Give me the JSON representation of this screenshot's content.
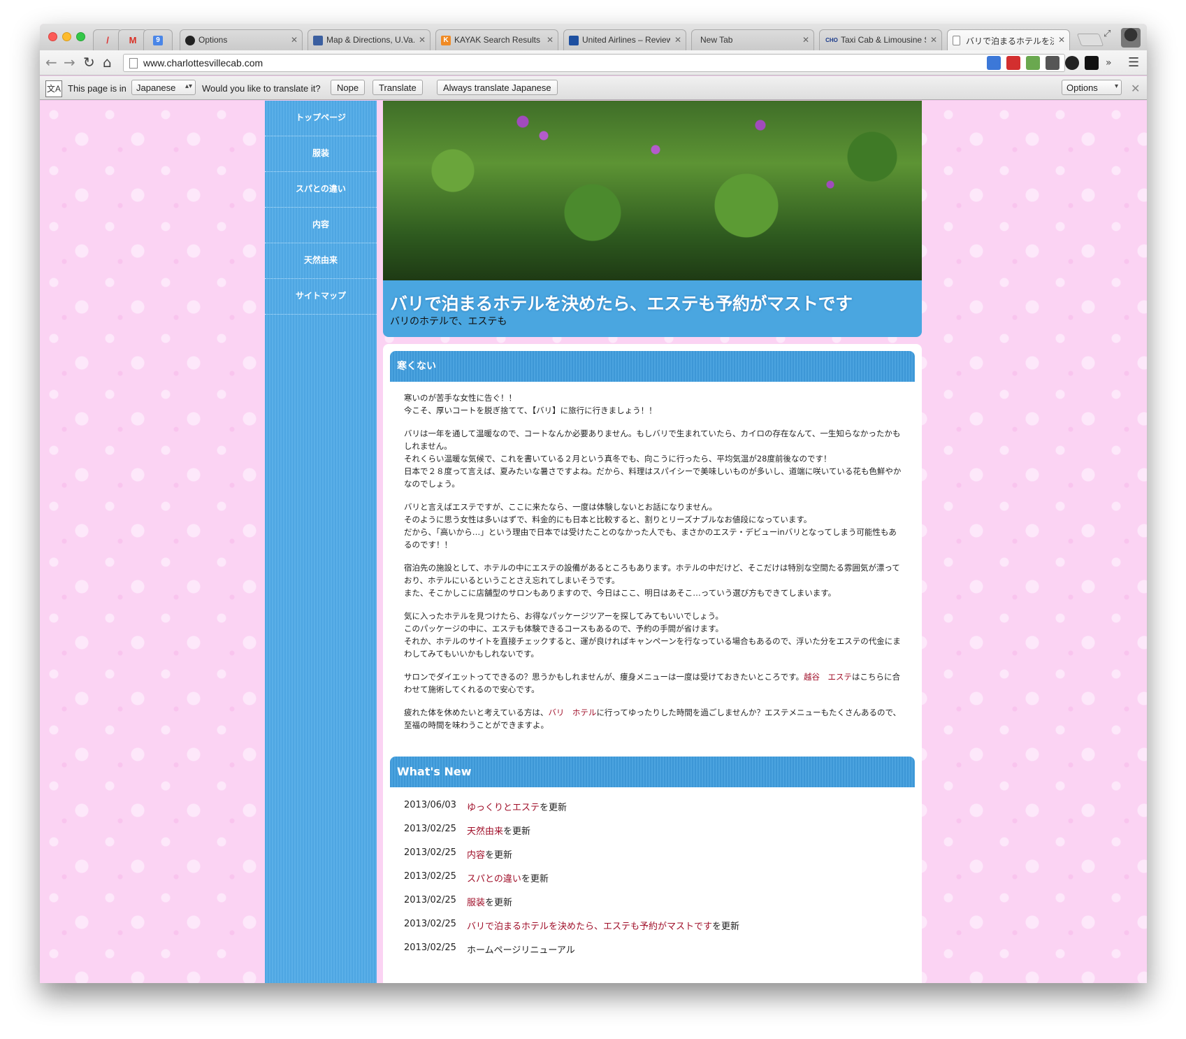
{
  "browser": {
    "tabs": [
      {
        "title": "",
        "icon": "pencil-icon"
      },
      {
        "title": "",
        "icon": "gmail-icon"
      },
      {
        "title": "",
        "icon": "calendar-icon"
      },
      {
        "title": "Options",
        "icon": "github-icon"
      },
      {
        "title": "Map & Directions, U.Va.",
        "icon": "uva-icon"
      },
      {
        "title": "KAYAK Search Results",
        "icon": "kayak-icon"
      },
      {
        "title": "United Airlines – Review",
        "icon": "united-icon"
      },
      {
        "title": "New Tab",
        "icon": ""
      },
      {
        "title": "Taxi Cab & Limousine Se",
        "icon": "cab-icon"
      },
      {
        "title": "バリで泊まるホテルを決め",
        "icon": "page-icon"
      }
    ],
    "url": "www.charlottesvillecab.com",
    "translate_bar": {
      "page_is_in": "This page is in",
      "language": "Japanese",
      "question": "Would you like to translate it?",
      "nope": "Nope",
      "translate": "Translate",
      "always": "Always translate Japanese",
      "options": "Options"
    }
  },
  "nav": {
    "items": [
      "トップページ",
      "服装",
      "スパとの違い",
      "内容",
      "天然由来",
      "サイトマップ"
    ]
  },
  "hero": {
    "title": "バリで泊まるホテルを決めたら、エステも予約がマストです",
    "subtitle": "バリのホテルで、エステも"
  },
  "section1": {
    "heading": "寒くない",
    "p1_l1": "寒いのが苦手な女性に告ぐ！！",
    "p1_l2": "今こそ、厚いコートを脱ぎ捨てて、【バリ】に旅行に行きましょう！！",
    "p2": "バリは一年を通して温暖なので、コートなんか必要ありません。もしバリで生まれていたら、カイロの存在なんて、一生知らなかったかもしれません。",
    "p2_l2": "それくらい温暖な気候で、これを書いている２月という真冬でも、向こうに行ったら、平均気温が28度前後なのです！",
    "p2_l3": "日本で２８度って言えば、夏みたいな暑さですよね。だから、料理はスパイシーで美味しいものが多いし、道端に咲いている花も色鮮やかなのでしょう。",
    "p3_l1": "バリと言えばエステですが、ここに来たなら、一度は体験しないとお話になりません。",
    "p3_l2": "そのように思う女性は多いはずで、料金的にも日本と比較すると、割りとリーズナブルなお値段になっています。",
    "p3_l3": "だから、「高いから…」という理由で日本では受けたことのなかった人でも、まさかのエステ・デビューinバリとなってしまう可能性もあるのです！！",
    "p4_l1": "宿泊先の施設として、ホテルの中にエステの設備があるところもあります。ホテルの中だけど、そこだけは特別な空間たる雰囲気が漂っており、ホテルにいるということさえ忘れてしまいそうです。",
    "p4_l2": "また、そこかしこに店舗型のサロンもありますので、今日はここ、明日はあそこ…っていう選び方もできてしまいます。",
    "p5_l1": "気に入ったホテルを見つけたら、お得なパッケージツアーを探してみてもいいでしょう。",
    "p5_l2": "このパッケージの中に、エステも体験できるコースもあるので、予約の手間が省けます。",
    "p5_l3": "それか、ホテルのサイトを直接チェックすると、運が良ければキャンペーンを行なっている場合もあるので、浮いた分をエステの代金にまわしてみてもいいかもしれないです。",
    "p6_a": "サロンでダイエットってできるの？思うかもしれませんが、痩身メニューは一度は受けておきたいところです。",
    "p6_link": "越谷　エステ",
    "p6_b": "はこちらに合わせて施術してくれるので安心です。",
    "p7_a": "疲れた体を休めたいと考えている方は、",
    "p7_link": "バリ　ホテル",
    "p7_b": "に行ってゆったりした時間を過ごしませんか？エステメニューもたくさんあるので、至福の時間を味わうことができますよ。"
  },
  "whats_new": {
    "heading": "What's New",
    "items": [
      {
        "date": "2013/06/03",
        "link": "ゆっくりとエステ",
        "suffix": "を更新"
      },
      {
        "date": "2013/02/25",
        "link": "天然由来",
        "suffix": "を更新"
      },
      {
        "date": "2013/02/25",
        "link": "内容",
        "suffix": "を更新"
      },
      {
        "date": "2013/02/25",
        "link": "スパとの違い",
        "suffix": "を更新"
      },
      {
        "date": "2013/02/25",
        "link": "服装",
        "suffix": "を更新"
      },
      {
        "date": "2013/02/25",
        "link": "バリで泊まるホテルを決めたら、エステも予約がマストです",
        "suffix": "を更新"
      },
      {
        "date": "2013/02/25",
        "link": "",
        "suffix": "ホームページリニューアル"
      }
    ]
  },
  "colors": {
    "accent_blue": "#4ea6e2",
    "link_red": "#a0102a",
    "page_pink": "#fbd3f3"
  }
}
